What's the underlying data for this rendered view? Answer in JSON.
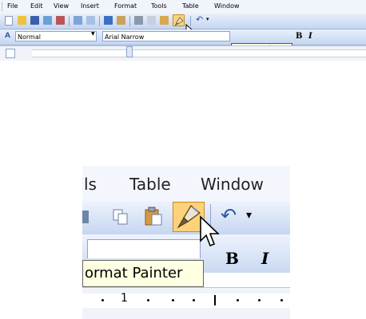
{
  "small": {
    "menu": [
      "File",
      "Edit",
      "View",
      "Insert",
      "Format",
      "Tools",
      "Table",
      "Window"
    ],
    "style_value": "Normal",
    "font_value": "Arial Narrow",
    "tooltip": "Format Painter"
  },
  "zoom": {
    "menu": [
      "ls",
      "Table",
      "Window"
    ],
    "tooltip": "ormat Painter",
    "bold_label": "B",
    "italic_label": "I",
    "ruler_number": "1"
  },
  "colors": {
    "toolbar_light": "#e9f0fb",
    "toolbar_dark": "#c4d5f0",
    "tooltip_bg": "#ffffe1",
    "highlight": "#ffd27a"
  }
}
